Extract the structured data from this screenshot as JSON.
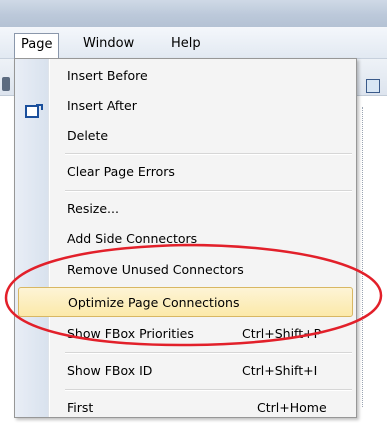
{
  "menubar": {
    "items": [
      {
        "label": "Page"
      },
      {
        "label": "Window"
      },
      {
        "label": "Help"
      }
    ]
  },
  "menu": {
    "items": [
      {
        "label": "Insert Before",
        "shortcut": ""
      },
      {
        "label": "Insert After",
        "shortcut": "",
        "icon": "insert-after-icon"
      },
      {
        "label": "Delete",
        "shortcut": ""
      },
      {
        "label": "Clear Page Errors",
        "shortcut": ""
      },
      {
        "label": "Resize...",
        "shortcut": ""
      },
      {
        "label": "Add Side Connectors",
        "shortcut": ""
      },
      {
        "label": "Remove Unused Connectors",
        "shortcut": ""
      },
      {
        "label": "Optimize Page Connections",
        "shortcut": ""
      },
      {
        "label": "Show FBox Priorities",
        "shortcut": "Ctrl+Shift+P"
      },
      {
        "label": "Show FBox ID",
        "shortcut": "Ctrl+Shift+I"
      },
      {
        "label": "First",
        "shortcut": "Ctrl+Home"
      }
    ],
    "highlighted": "Optimize Page Connections"
  },
  "annotation": {
    "color": "#e2202a"
  },
  "colors": {
    "highlight": "#fce9a9",
    "highlight_border": "#d8b763"
  }
}
